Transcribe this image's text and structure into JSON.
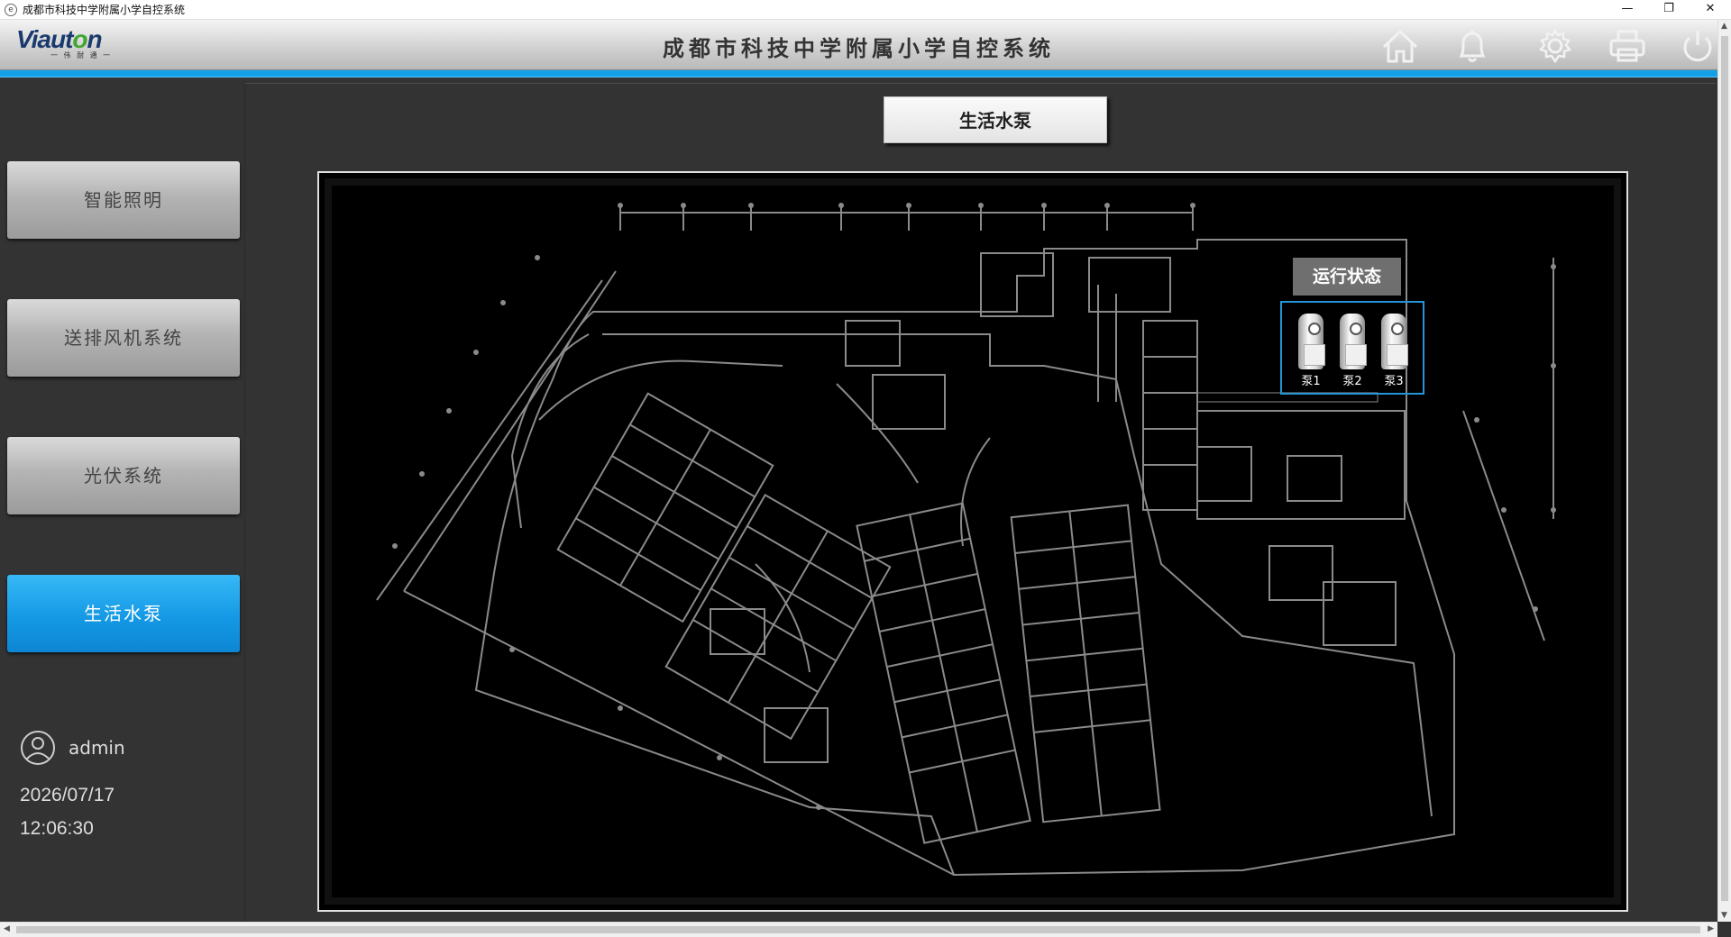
{
  "window": {
    "title": "成都市科技中学附属小学自控系统",
    "minimize": "—",
    "restore": "❐",
    "close": "✕"
  },
  "header": {
    "logo": {
      "brand_prefix": "Viaut",
      "brand_o": "o",
      "brand_suffix": "n",
      "sub": "一 伟 耐 通 一"
    },
    "title": "成都市科技中学附属小学自控系统",
    "icons": [
      "home-icon",
      "bell-icon",
      "gear-icon",
      "printer-icon",
      "power-icon"
    ]
  },
  "sidebar": {
    "items": [
      {
        "label": "智能照明",
        "active": false
      },
      {
        "label": "送排风机系统",
        "active": false
      },
      {
        "label": "光伏系统",
        "active": false
      },
      {
        "label": "生活水泵",
        "active": true
      }
    ]
  },
  "user": {
    "name": "admin",
    "date": "2026/07/17",
    "time": "12:06:30"
  },
  "main": {
    "page_title": "生活水泵",
    "status_label": "运行状态",
    "pumps": [
      "泵1",
      "泵2",
      "泵3"
    ]
  },
  "colors": {
    "accent": "#14a0e6",
    "background": "#333333",
    "plan_lines": "#9a9a9a"
  }
}
